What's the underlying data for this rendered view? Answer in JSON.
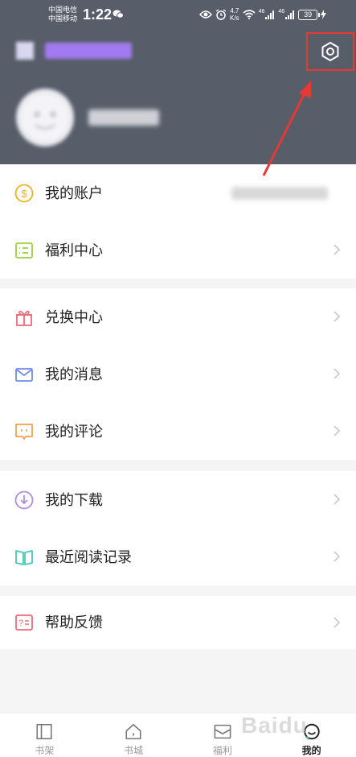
{
  "status_bar": {
    "carrier_1": "中国电信",
    "carrier_2": "中国移动",
    "time": "1:22",
    "speed_value": "4.7",
    "speed_unit": "K/s",
    "signal_tag_1": "46",
    "signal_tag_2": "46",
    "battery": "39"
  },
  "menu": {
    "group1": [
      {
        "label": "我的账户",
        "icon": "coin-icon",
        "color": "#f3b12a"
      },
      {
        "label": "福利中心",
        "icon": "list-icon",
        "color": "#9dcf3e"
      }
    ],
    "group2": [
      {
        "label": "兑换中心",
        "icon": "gift-icon",
        "color": "#ef6a7b"
      },
      {
        "label": "我的消息",
        "icon": "mail-icon",
        "color": "#6b8fe6"
      },
      {
        "label": "我的评论",
        "icon": "comment-icon",
        "color": "#f2a24a"
      }
    ],
    "group3": [
      {
        "label": "我的下载",
        "icon": "download-icon",
        "color": "#b08ae6"
      },
      {
        "label": "最近阅读记录",
        "icon": "book-icon",
        "color": "#4cc7b6"
      }
    ],
    "group4": [
      {
        "label": "帮助反馈",
        "icon": "help-icon",
        "color": "#ef6a7b"
      }
    ]
  },
  "bottom_nav": [
    {
      "label": "书架",
      "icon": "bookshelf-icon"
    },
    {
      "label": "书城",
      "icon": "home-icon"
    },
    {
      "label": "福利",
      "icon": "envelope-icon"
    },
    {
      "label": "我的",
      "icon": "profile-icon",
      "active": true
    }
  ],
  "watermark": "Baidu",
  "colors": {
    "header_bg": "#575e6a",
    "highlight_red": "#e53935",
    "page_bg": "#f5f5f5"
  }
}
